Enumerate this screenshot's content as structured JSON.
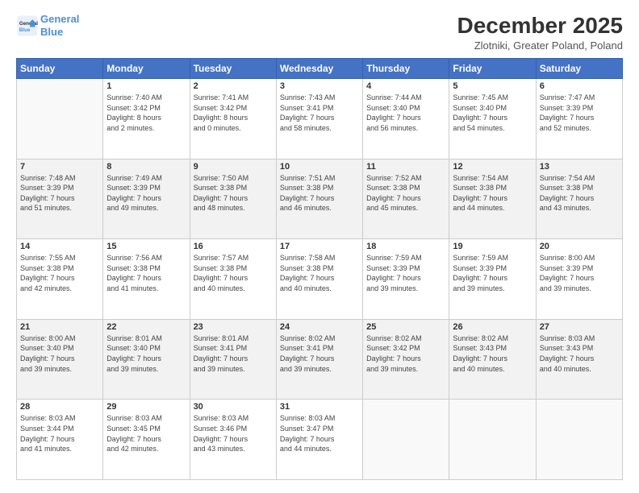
{
  "logo": {
    "line1": "General",
    "line2": "Blue"
  },
  "title": "December 2025",
  "location": "Zlotniki, Greater Poland, Poland",
  "days_header": [
    "Sunday",
    "Monday",
    "Tuesday",
    "Wednesday",
    "Thursday",
    "Friday",
    "Saturday"
  ],
  "weeks": [
    [
      {
        "day": "",
        "info": ""
      },
      {
        "day": "1",
        "info": "Sunrise: 7:40 AM\nSunset: 3:42 PM\nDaylight: 8 hours\nand 2 minutes."
      },
      {
        "day": "2",
        "info": "Sunrise: 7:41 AM\nSunset: 3:42 PM\nDaylight: 8 hours\nand 0 minutes."
      },
      {
        "day": "3",
        "info": "Sunrise: 7:43 AM\nSunset: 3:41 PM\nDaylight: 7 hours\nand 58 minutes."
      },
      {
        "day": "4",
        "info": "Sunrise: 7:44 AM\nSunset: 3:40 PM\nDaylight: 7 hours\nand 56 minutes."
      },
      {
        "day": "5",
        "info": "Sunrise: 7:45 AM\nSunset: 3:40 PM\nDaylight: 7 hours\nand 54 minutes."
      },
      {
        "day": "6",
        "info": "Sunrise: 7:47 AM\nSunset: 3:39 PM\nDaylight: 7 hours\nand 52 minutes."
      }
    ],
    [
      {
        "day": "7",
        "info": "Sunrise: 7:48 AM\nSunset: 3:39 PM\nDaylight: 7 hours\nand 51 minutes."
      },
      {
        "day": "8",
        "info": "Sunrise: 7:49 AM\nSunset: 3:39 PM\nDaylight: 7 hours\nand 49 minutes."
      },
      {
        "day": "9",
        "info": "Sunrise: 7:50 AM\nSunset: 3:38 PM\nDaylight: 7 hours\nand 48 minutes."
      },
      {
        "day": "10",
        "info": "Sunrise: 7:51 AM\nSunset: 3:38 PM\nDaylight: 7 hours\nand 46 minutes."
      },
      {
        "day": "11",
        "info": "Sunrise: 7:52 AM\nSunset: 3:38 PM\nDaylight: 7 hours\nand 45 minutes."
      },
      {
        "day": "12",
        "info": "Sunrise: 7:54 AM\nSunset: 3:38 PM\nDaylight: 7 hours\nand 44 minutes."
      },
      {
        "day": "13",
        "info": "Sunrise: 7:54 AM\nSunset: 3:38 PM\nDaylight: 7 hours\nand 43 minutes."
      }
    ],
    [
      {
        "day": "14",
        "info": "Sunrise: 7:55 AM\nSunset: 3:38 PM\nDaylight: 7 hours\nand 42 minutes."
      },
      {
        "day": "15",
        "info": "Sunrise: 7:56 AM\nSunset: 3:38 PM\nDaylight: 7 hours\nand 41 minutes."
      },
      {
        "day": "16",
        "info": "Sunrise: 7:57 AM\nSunset: 3:38 PM\nDaylight: 7 hours\nand 40 minutes."
      },
      {
        "day": "17",
        "info": "Sunrise: 7:58 AM\nSunset: 3:38 PM\nDaylight: 7 hours\nand 40 minutes."
      },
      {
        "day": "18",
        "info": "Sunrise: 7:59 AM\nSunset: 3:39 PM\nDaylight: 7 hours\nand 39 minutes."
      },
      {
        "day": "19",
        "info": "Sunrise: 7:59 AM\nSunset: 3:39 PM\nDaylight: 7 hours\nand 39 minutes."
      },
      {
        "day": "20",
        "info": "Sunrise: 8:00 AM\nSunset: 3:39 PM\nDaylight: 7 hours\nand 39 minutes."
      }
    ],
    [
      {
        "day": "21",
        "info": "Sunrise: 8:00 AM\nSunset: 3:40 PM\nDaylight: 7 hours\nand 39 minutes."
      },
      {
        "day": "22",
        "info": "Sunrise: 8:01 AM\nSunset: 3:40 PM\nDaylight: 7 hours\nand 39 minutes."
      },
      {
        "day": "23",
        "info": "Sunrise: 8:01 AM\nSunset: 3:41 PM\nDaylight: 7 hours\nand 39 minutes."
      },
      {
        "day": "24",
        "info": "Sunrise: 8:02 AM\nSunset: 3:41 PM\nDaylight: 7 hours\nand 39 minutes."
      },
      {
        "day": "25",
        "info": "Sunrise: 8:02 AM\nSunset: 3:42 PM\nDaylight: 7 hours\nand 39 minutes."
      },
      {
        "day": "26",
        "info": "Sunrise: 8:02 AM\nSunset: 3:43 PM\nDaylight: 7 hours\nand 40 minutes."
      },
      {
        "day": "27",
        "info": "Sunrise: 8:03 AM\nSunset: 3:43 PM\nDaylight: 7 hours\nand 40 minutes."
      }
    ],
    [
      {
        "day": "28",
        "info": "Sunrise: 8:03 AM\nSunset: 3:44 PM\nDaylight: 7 hours\nand 41 minutes."
      },
      {
        "day": "29",
        "info": "Sunrise: 8:03 AM\nSunset: 3:45 PM\nDaylight: 7 hours\nand 42 minutes."
      },
      {
        "day": "30",
        "info": "Sunrise: 8:03 AM\nSunset: 3:46 PM\nDaylight: 7 hours\nand 43 minutes."
      },
      {
        "day": "31",
        "info": "Sunrise: 8:03 AM\nSunset: 3:47 PM\nDaylight: 7 hours\nand 44 minutes."
      },
      {
        "day": "",
        "info": ""
      },
      {
        "day": "",
        "info": ""
      },
      {
        "day": "",
        "info": ""
      }
    ]
  ]
}
